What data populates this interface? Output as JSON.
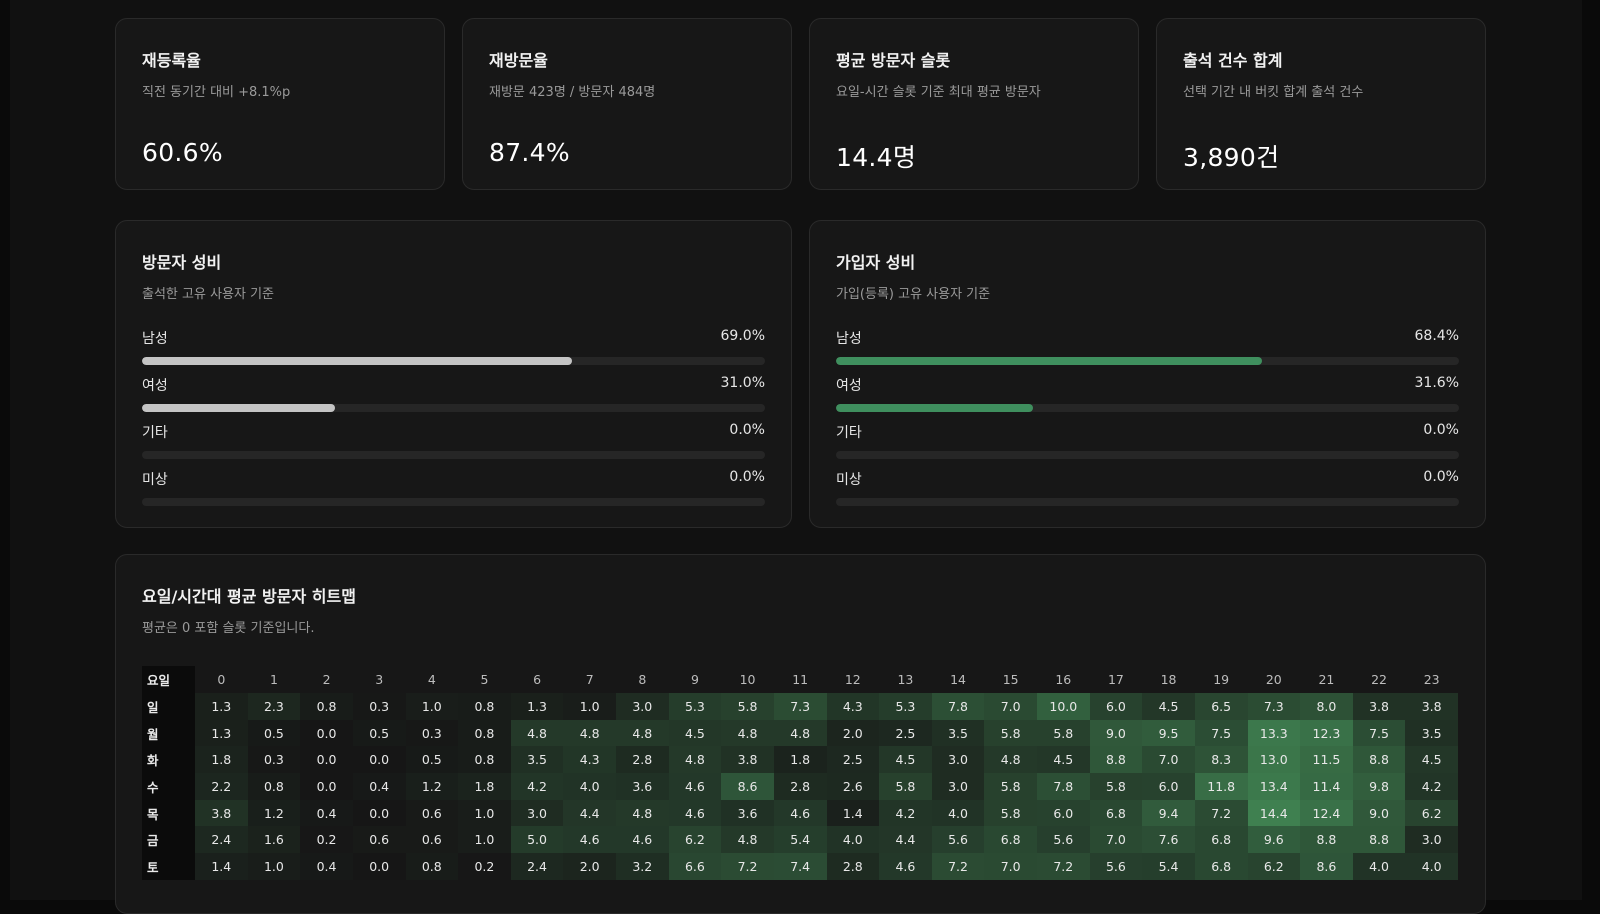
{
  "kpis": [
    {
      "title": "재등록율",
      "subtitle": "직전 동기간 대비 +8.1%p",
      "value": "60.6%"
    },
    {
      "title": "재방문율",
      "subtitle": "재방문 423명 / 방문자 484명",
      "value": "87.4%"
    },
    {
      "title": "평균 방문자 슬롯",
      "subtitle": "요일-시간 슬롯 기준 최대 평균 방문자",
      "value": "14.4명"
    },
    {
      "title": "출석 건수 합계",
      "subtitle": "선택 기간 내 버킷 합계 출석 건수",
      "value": "3,890건"
    }
  ],
  "visitor_gender": {
    "title": "방문자 성비",
    "subtitle": "출석한 고유 사용자 기준",
    "bar_color": "#c4c4c4",
    "rows": [
      {
        "label": "남성",
        "value_text": "69.0%",
        "pct": 69.0
      },
      {
        "label": "여성",
        "value_text": "31.0%",
        "pct": 31.0
      },
      {
        "label": "기타",
        "value_text": "0.0%",
        "pct": 0.0
      },
      {
        "label": "미상",
        "value_text": "0.0%",
        "pct": 0.0
      }
    ]
  },
  "member_gender": {
    "title": "가입자 성비",
    "subtitle": "가입(등록) 고유 사용자 기준",
    "bar_color": "#3f8f5e",
    "rows": [
      {
        "label": "남성",
        "value_text": "68.4%",
        "pct": 68.4
      },
      {
        "label": "여성",
        "value_text": "31.6%",
        "pct": 31.6
      },
      {
        "label": "기타",
        "value_text": "0.0%",
        "pct": 0.0
      },
      {
        "label": "미상",
        "value_text": "0.0%",
        "pct": 0.0
      }
    ]
  },
  "heatmap": {
    "title": "요일/시간대 평균 방문자 히트맵",
    "subtitle": "평균은 0 포함 슬롯 기준입니다.",
    "corner_label": "요일",
    "hours": [
      "0",
      "1",
      "2",
      "3",
      "4",
      "5",
      "6",
      "7",
      "8",
      "9",
      "10",
      "11",
      "12",
      "13",
      "14",
      "15",
      "16",
      "17",
      "18",
      "19",
      "20",
      "21",
      "22",
      "23"
    ],
    "rows": [
      {
        "day": "일",
        "values": [
          1.3,
          2.3,
          0.8,
          0.3,
          1.0,
          0.8,
          1.3,
          1.0,
          3.0,
          5.3,
          5.8,
          7.3,
          4.3,
          5.3,
          7.8,
          7.0,
          10.0,
          6.0,
          4.5,
          6.5,
          7.3,
          8.0,
          3.8,
          3.8
        ]
      },
      {
        "day": "월",
        "values": [
          1.3,
          0.5,
          0.0,
          0.5,
          0.3,
          0.8,
          4.8,
          4.8,
          4.8,
          4.5,
          4.8,
          4.8,
          2.0,
          2.5,
          3.5,
          5.8,
          5.8,
          9.0,
          9.5,
          7.5,
          13.3,
          12.3,
          7.5,
          3.5
        ]
      },
      {
        "day": "화",
        "values": [
          1.8,
          0.3,
          0.0,
          0.0,
          0.5,
          0.8,
          3.5,
          4.3,
          2.8,
          4.8,
          3.8,
          1.8,
          2.5,
          4.5,
          3.0,
          4.8,
          4.5,
          8.8,
          7.0,
          8.3,
          13.0,
          11.5,
          8.8,
          4.5
        ]
      },
      {
        "day": "수",
        "values": [
          2.2,
          0.8,
          0.0,
          0.4,
          1.2,
          1.8,
          4.2,
          4.0,
          3.6,
          4.6,
          8.6,
          2.8,
          2.6,
          5.8,
          3.0,
          5.8,
          7.8,
          5.8,
          6.0,
          11.8,
          13.4,
          11.4,
          9.8,
          4.2
        ]
      },
      {
        "day": "목",
        "values": [
          3.8,
          1.2,
          0.4,
          0.0,
          0.6,
          1.0,
          3.0,
          4.4,
          4.8,
          4.6,
          3.6,
          4.6,
          1.4,
          4.2,
          4.0,
          5.8,
          6.0,
          6.8,
          9.4,
          7.2,
          14.4,
          12.4,
          9.0,
          6.2
        ]
      },
      {
        "day": "금",
        "values": [
          2.4,
          1.6,
          0.2,
          0.6,
          0.6,
          1.0,
          5.0,
          4.6,
          4.6,
          6.2,
          4.8,
          5.4,
          4.0,
          4.4,
          5.6,
          6.8,
          5.6,
          7.0,
          7.6,
          6.8,
          9.6,
          8.8,
          8.8,
          3.0
        ]
      },
      {
        "day": "토",
        "values": [
          1.4,
          1.0,
          0.4,
          0.0,
          0.8,
          0.2,
          2.4,
          2.0,
          3.2,
          6.6,
          7.2,
          7.4,
          2.8,
          4.6,
          7.2,
          7.0,
          7.2,
          5.6,
          5.4,
          6.8,
          6.2,
          8.6,
          4.0,
          4.0
        ]
      }
    ],
    "max_value": 14.4,
    "low_color": "#161616",
    "high_color": "#3f8050"
  }
}
